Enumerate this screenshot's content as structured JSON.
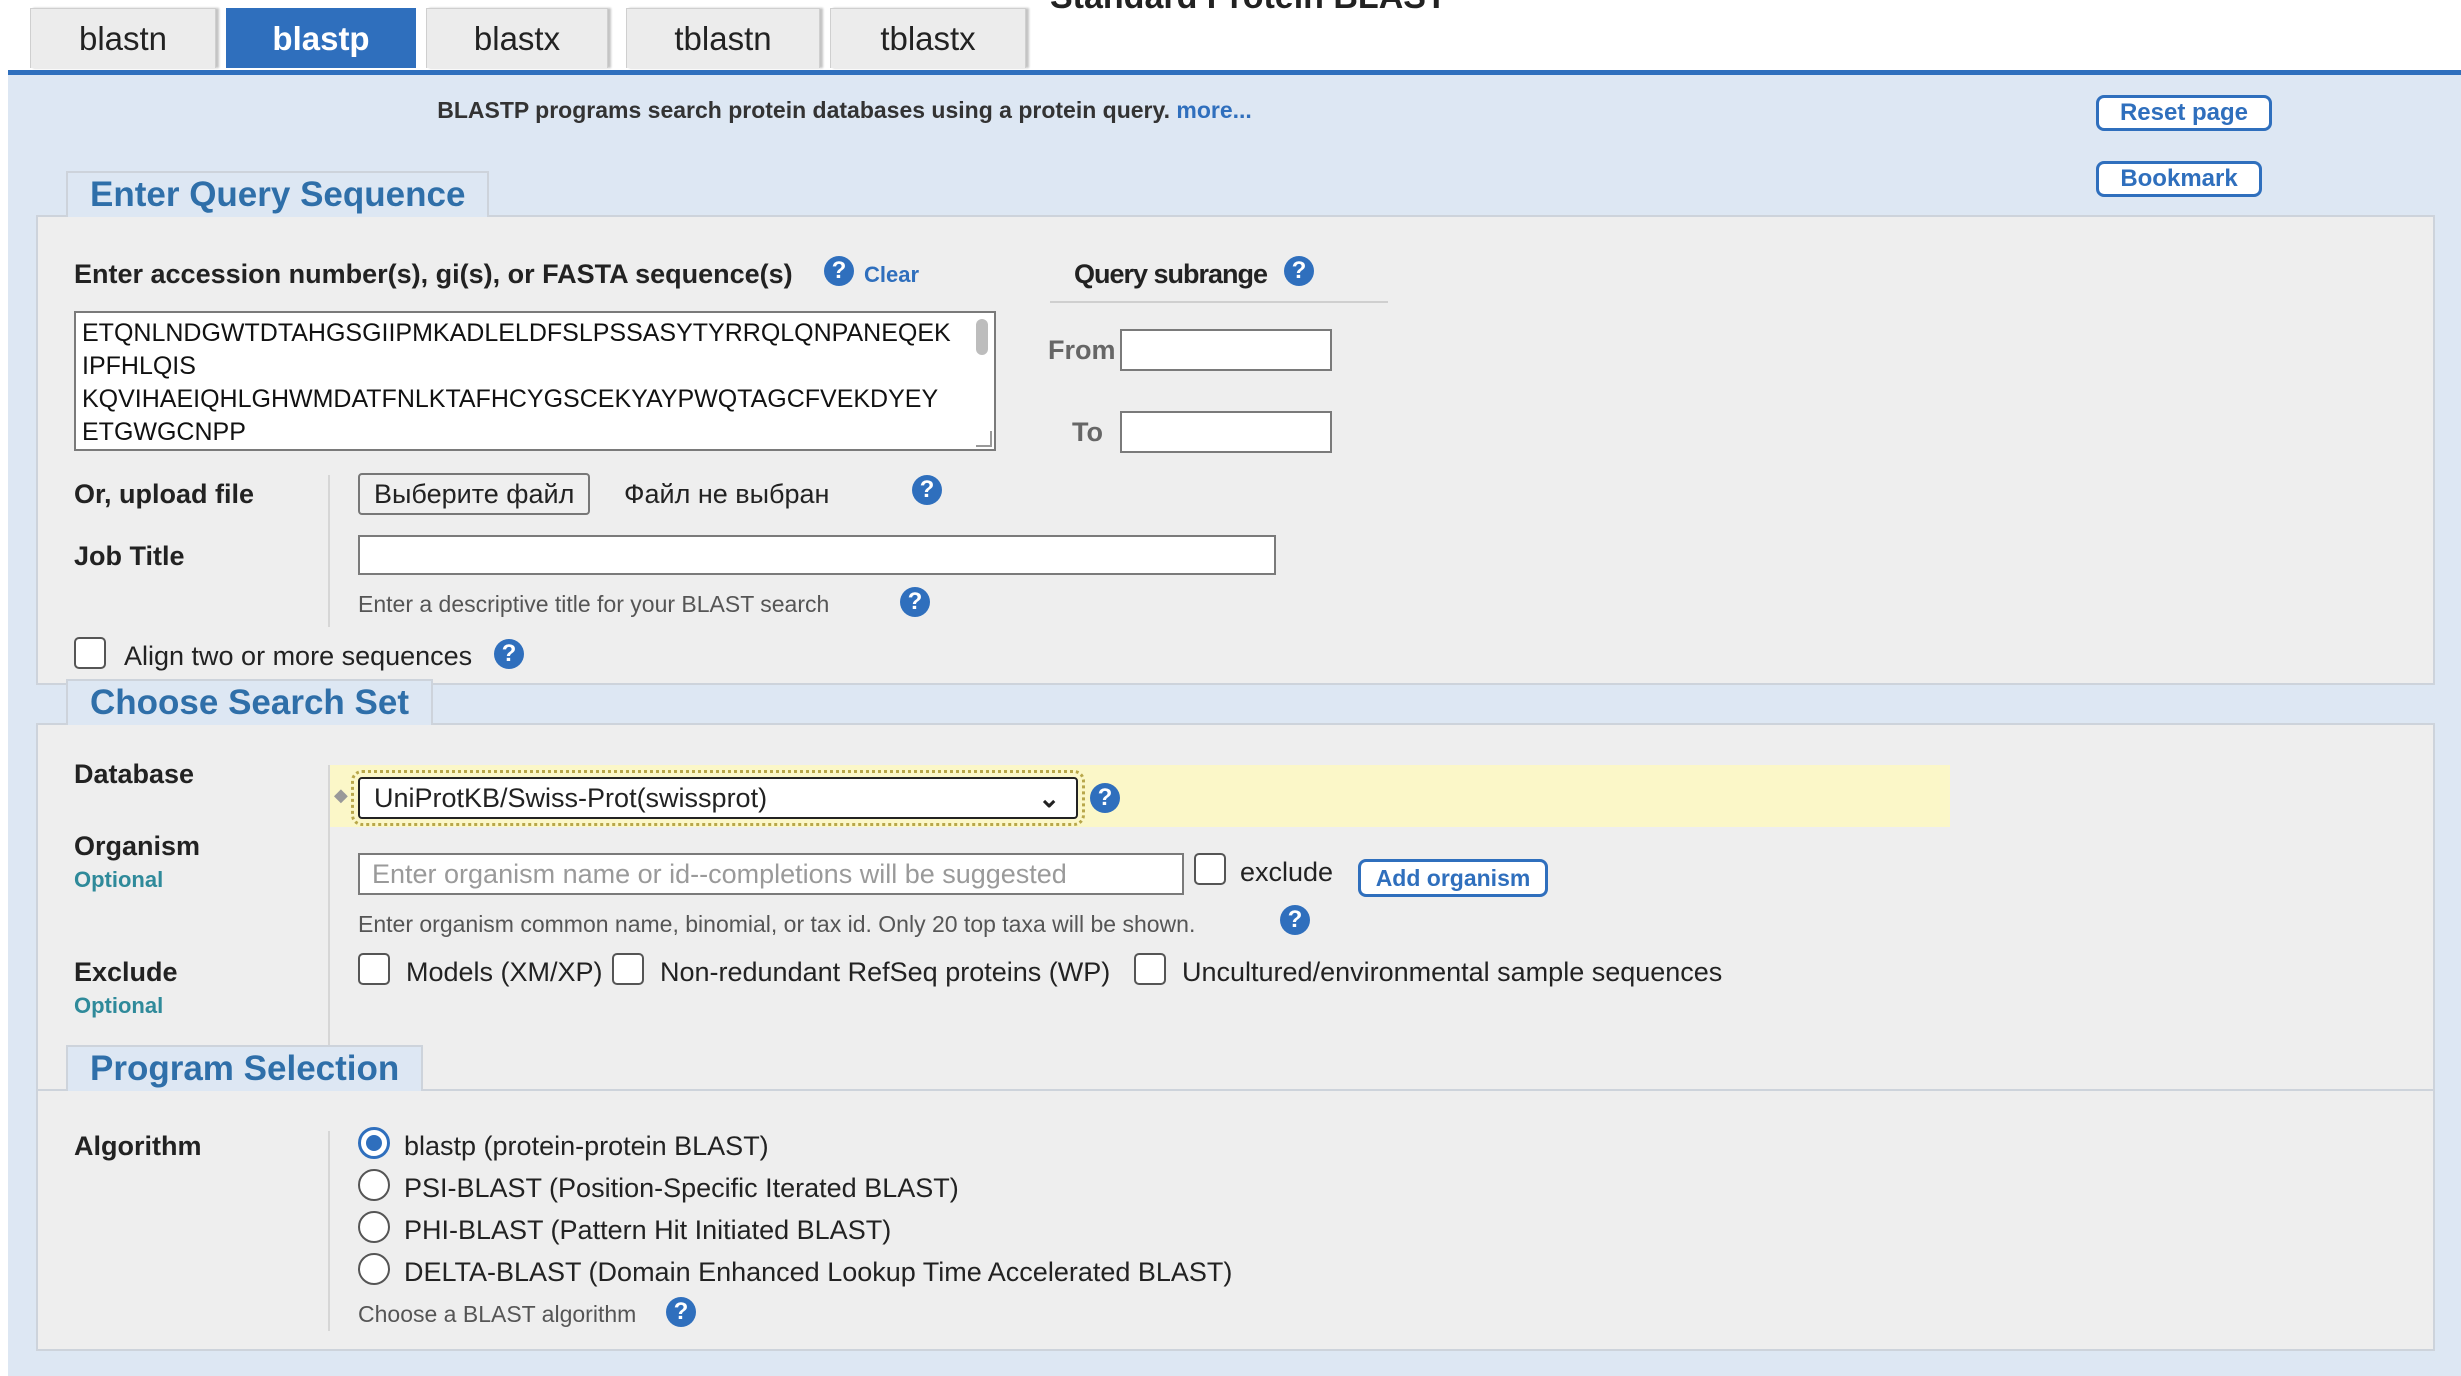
{
  "page_heading": "Standard Protein BLAST",
  "tabs": [
    {
      "label": "blastn"
    },
    {
      "label": "blastp",
      "active": true
    },
    {
      "label": "blastx"
    },
    {
      "label": "tblastn"
    },
    {
      "label": "tblastx"
    }
  ],
  "intro": {
    "text": "BLASTP programs search protein databases using a protein query.",
    "more_link": "more..."
  },
  "side_buttons": {
    "reset": "Reset page",
    "bookmark": "Bookmark"
  },
  "query_section": {
    "legend": "Enter Query Sequence",
    "accession_label": "Enter accession number(s), gi(s), or FASTA sequence(s)",
    "clear_link": "Clear",
    "sequence_lines": [
      "ETQNLNDGWTDTAHGSGIIPMKADLELDFSLPSSASYTYRRQLQNPANEQEK",
      "IPFHLQIS",
      "KQVIHAEIQHLGHWMDATFNLKTAFHCYGSCEKYAYPWQTAGCFVEKDYEY",
      "ETGWGCNPP"
    ],
    "subrange": {
      "title": "Query subrange",
      "from_label": "From",
      "to_label": "To",
      "from_value": "",
      "to_value": ""
    },
    "upload_label": "Or, upload file",
    "file_button": "Выберите файл",
    "file_status": "Файл не выбран",
    "job_title_label": "Job Title",
    "job_title_value": "",
    "job_title_hint": "Enter a descriptive title for your BLAST search",
    "align_label": "Align two or more sequences"
  },
  "search_set": {
    "legend": "Choose Search Set",
    "database_label": "Database",
    "database_value": "UniProtKB/Swiss-Prot(swissprot)",
    "organism_label": "Organism",
    "optional": "Optional",
    "organism_placeholder": "Enter organism name or id--completions will be suggested",
    "exclude_checkbox_label": "exclude",
    "add_organism": "Add organism",
    "organism_hint": "Enter organism common name, binomial, or tax id. Only 20 top taxa will be shown.",
    "exclude_label": "Exclude",
    "exclude_options": [
      "Models (XM/XP)",
      "Non-redundant RefSeq proteins (WP)",
      "Uncultured/environmental sample sequences"
    ]
  },
  "program": {
    "legend": "Program Selection",
    "algorithm_label": "Algorithm",
    "options": [
      "blastp (protein-protein BLAST)",
      "PSI-BLAST (Position-Specific Iterated BLAST)",
      "PHI-BLAST (Pattern Hit Initiated BLAST)",
      "DELTA-BLAST (Domain Enhanced Lookup Time Accelerated BLAST)"
    ],
    "selected_index": 0,
    "hint": "Choose a BLAST algorithm"
  },
  "colors": {
    "accent": "#2f6fbd",
    "panel": "#dde7f3",
    "legend_text": "#2f6fa9",
    "db_highlight": "#fbf7c8"
  }
}
